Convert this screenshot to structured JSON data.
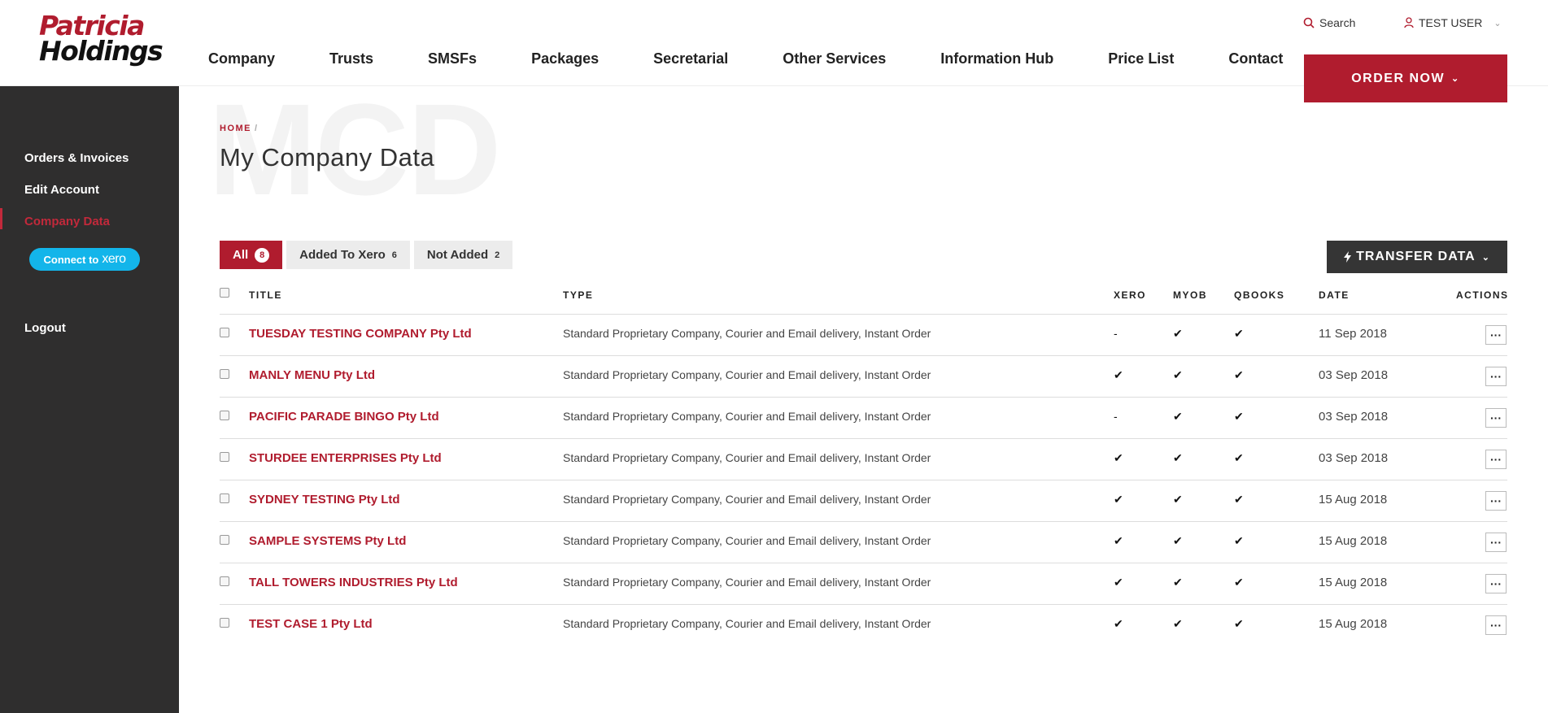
{
  "header": {
    "logo_line1": "Patricia",
    "logo_line2": "Holdings",
    "nav": [
      "Company",
      "Trusts",
      "SMSFs",
      "Packages",
      "Secretarial",
      "Other Services",
      "Information Hub",
      "Price List",
      "Contact"
    ],
    "search_label": "Search",
    "user_label": "TEST USER",
    "order_label": "ORDER NOW"
  },
  "sidebar": {
    "items": [
      "Orders & Invoices",
      "Edit Account",
      "Company Data"
    ],
    "xero_connect_label": "Connect to",
    "xero_word": "xero",
    "logout_label": "Logout"
  },
  "main": {
    "watermark": "MCD",
    "breadcrumb": "HOME",
    "breadcrumb_sep": "/",
    "title": "My Company Data",
    "filters": [
      {
        "label": "All",
        "count": "8"
      },
      {
        "label": "Added To Xero",
        "count": "6"
      },
      {
        "label": "Not Added",
        "count": "2"
      }
    ],
    "transfer_label": "TRANSFER DATA"
  },
  "table": {
    "headers": {
      "title": "TITLE",
      "type": "TYPE",
      "xero": "XERO",
      "myob": "MYOB",
      "qbooks": "QBOOKS",
      "date": "DATE",
      "actions": "ACTIONS"
    },
    "rows": [
      {
        "title": "TUESDAY TESTING COMPANY Pty Ltd",
        "type": "Standard Proprietary Company, Courier and Email delivery, Instant Order",
        "xero": "-",
        "myob": "✔",
        "qbooks": "✔",
        "date": "11 Sep 2018"
      },
      {
        "title": "MANLY MENU Pty Ltd",
        "type": "Standard Proprietary Company, Courier and Email delivery, Instant Order",
        "xero": "✔",
        "myob": "✔",
        "qbooks": "✔",
        "date": "03 Sep 2018"
      },
      {
        "title": "PACIFIC PARADE BINGO Pty Ltd",
        "type": "Standard Proprietary Company, Courier and Email delivery, Instant Order",
        "xero": "-",
        "myob": "✔",
        "qbooks": "✔",
        "date": "03 Sep 2018"
      },
      {
        "title": "STURDEE ENTERPRISES Pty Ltd",
        "type": "Standard Proprietary Company, Courier and Email delivery, Instant Order",
        "xero": "✔",
        "myob": "✔",
        "qbooks": "✔",
        "date": "03 Sep 2018"
      },
      {
        "title": "SYDNEY TESTING Pty Ltd",
        "type": "Standard Proprietary Company, Courier and Email delivery, Instant Order",
        "xero": "✔",
        "myob": "✔",
        "qbooks": "✔",
        "date": "15 Aug 2018"
      },
      {
        "title": "SAMPLE SYSTEMS Pty Ltd",
        "type": "Standard Proprietary Company, Courier and Email delivery, Instant Order",
        "xero": "✔",
        "myob": "✔",
        "qbooks": "✔",
        "date": "15 Aug 2018"
      },
      {
        "title": "TALL TOWERS INDUSTRIES Pty Ltd",
        "type": "Standard Proprietary Company, Courier and Email delivery, Instant Order",
        "xero": "✔",
        "myob": "✔",
        "qbooks": "✔",
        "date": "15 Aug 2018"
      },
      {
        "title": "TEST CASE 1 Pty Ltd",
        "type": "Standard Proprietary Company, Courier and Email delivery, Instant Order",
        "xero": "✔",
        "myob": "✔",
        "qbooks": "✔",
        "date": "15 Aug 2018"
      }
    ],
    "action_glyph": "···"
  },
  "colors": {
    "brand": "#b01c2e",
    "sidebar": "#2f2e2e",
    "xero": "#13b5ea",
    "dark_button": "#353535"
  }
}
